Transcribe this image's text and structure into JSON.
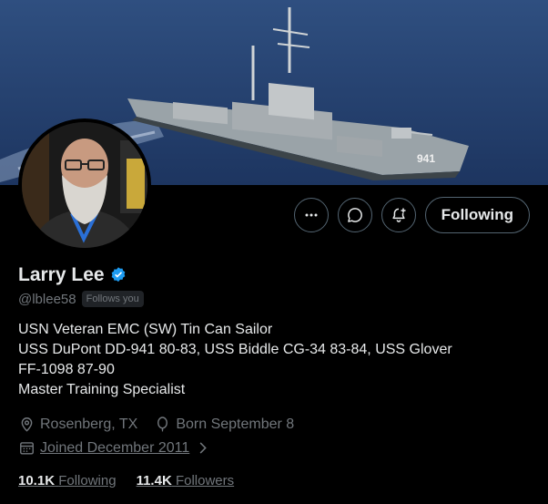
{
  "profile": {
    "name": "Larry Lee",
    "handle": "@lblee58",
    "follows_you_badge": "Follows you",
    "bio_lines": [
      "USN Veteran EMC (SW) Tin Can Sailor",
      "USS DuPont DD-941 80-83, USS Biddle CG-34 83-84, USS Glover",
      "FF-1098 87-90",
      "Master Training Specialist"
    ],
    "location": "Rosenberg, TX",
    "birthday": "Born September 8",
    "joined": "Joined December 2011",
    "following_count": "10.1K",
    "following_label": "Following",
    "followers_count": "11.4K",
    "followers_label": "Followers",
    "hull_number": "941"
  },
  "actions": {
    "more_icon": "more-icon",
    "message_icon": "message-icon",
    "notify_icon": "bell-plus-icon",
    "following_button": "Following"
  },
  "colors": {
    "background": "#000000",
    "text_primary": "#e7e9ea",
    "text_secondary": "#71767b",
    "verified": "#1d9bf0",
    "border": "#536471"
  }
}
